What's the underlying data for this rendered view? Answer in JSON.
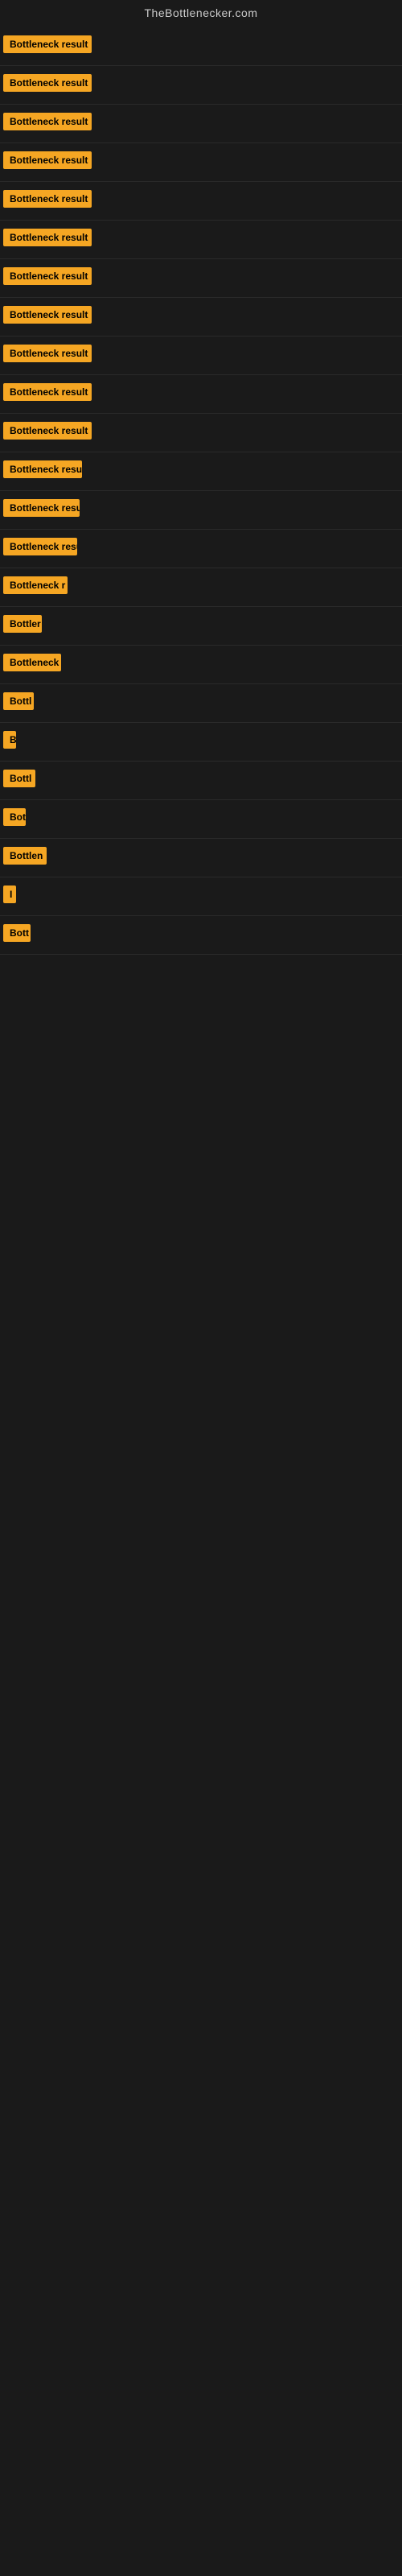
{
  "site": {
    "title": "TheBottlenecker.com"
  },
  "results": [
    {
      "id": 1,
      "label": "Bottleneck result",
      "badge_width": 110
    },
    {
      "id": 2,
      "label": "Bottleneck result",
      "badge_width": 110
    },
    {
      "id": 3,
      "label": "Bottleneck result",
      "badge_width": 110
    },
    {
      "id": 4,
      "label": "Bottleneck result",
      "badge_width": 110
    },
    {
      "id": 5,
      "label": "Bottleneck result",
      "badge_width": 110
    },
    {
      "id": 6,
      "label": "Bottleneck result",
      "badge_width": 110
    },
    {
      "id": 7,
      "label": "Bottleneck result",
      "badge_width": 110
    },
    {
      "id": 8,
      "label": "Bottleneck result",
      "badge_width": 110
    },
    {
      "id": 9,
      "label": "Bottleneck result",
      "badge_width": 110
    },
    {
      "id": 10,
      "label": "Bottleneck result",
      "badge_width": 110
    },
    {
      "id": 11,
      "label": "Bottleneck result",
      "badge_width": 110
    },
    {
      "id": 12,
      "label": "Bottleneck resu",
      "badge_width": 98
    },
    {
      "id": 13,
      "label": "Bottleneck resu",
      "badge_width": 95
    },
    {
      "id": 14,
      "label": "Bottleneck resu",
      "badge_width": 92
    },
    {
      "id": 15,
      "label": "Bottleneck r",
      "badge_width": 80
    },
    {
      "id": 16,
      "label": "Bottler",
      "badge_width": 48
    },
    {
      "id": 17,
      "label": "Bottleneck",
      "badge_width": 72
    },
    {
      "id": 18,
      "label": "Bottl",
      "badge_width": 38
    },
    {
      "id": 19,
      "label": "B",
      "badge_width": 14
    },
    {
      "id": 20,
      "label": "Bottl",
      "badge_width": 40
    },
    {
      "id": 21,
      "label": "Bot",
      "badge_width": 28
    },
    {
      "id": 22,
      "label": "Bottlen",
      "badge_width": 54
    },
    {
      "id": 23,
      "label": "I",
      "badge_width": 10
    },
    {
      "id": 24,
      "label": "Bott",
      "badge_width": 34
    }
  ]
}
